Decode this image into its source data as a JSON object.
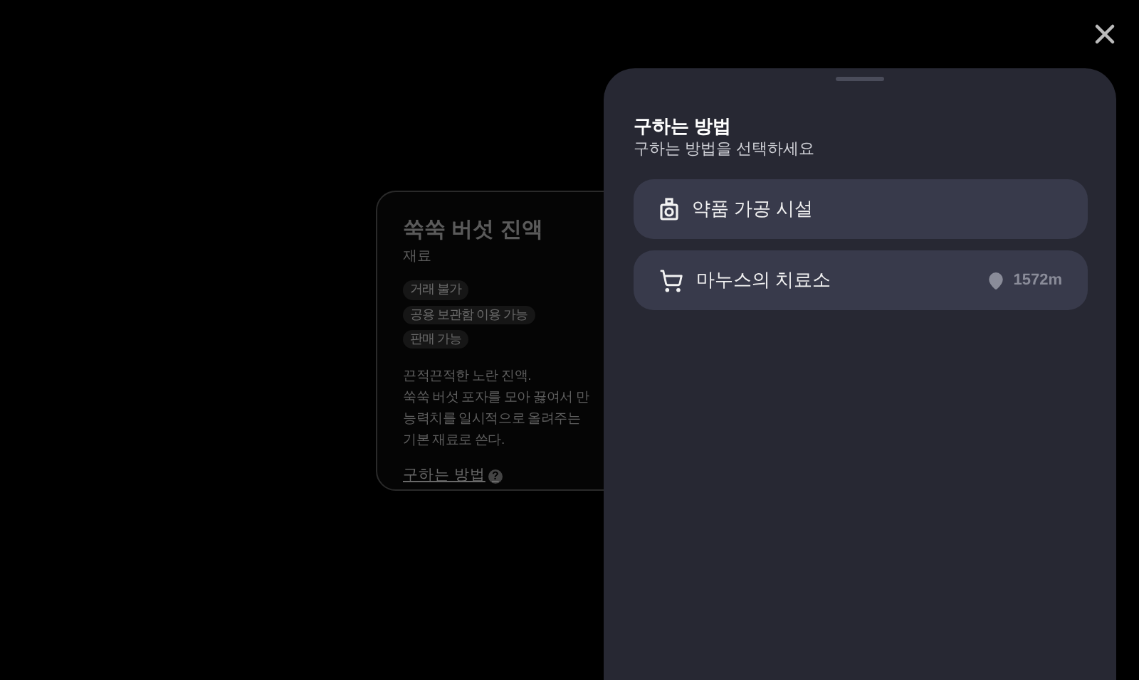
{
  "item_card": {
    "name": "쑥쑥 버섯 진액",
    "category": "재료",
    "tags": [
      "거래 불가",
      "공용 보관함 이용 가능",
      "판매 가능"
    ],
    "description": [
      "끈적끈적한 노란 진액.",
      "쑥쑥 버섯 포자를 모아 끓여서 만",
      "능력치를 일시적으로 올려주는",
      "기본 재료로 쓴다."
    ],
    "link": "구하는 방법",
    "link_icon": "?"
  },
  "sheet": {
    "title": "구하는 방법",
    "subtitle": "구하는 방법을 선택하세요",
    "options": [
      {
        "kind": "facility",
        "label": "약품 가공 시설"
      },
      {
        "kind": "shop",
        "label": "마누스의 치료소",
        "distance": "1572m"
      }
    ]
  }
}
